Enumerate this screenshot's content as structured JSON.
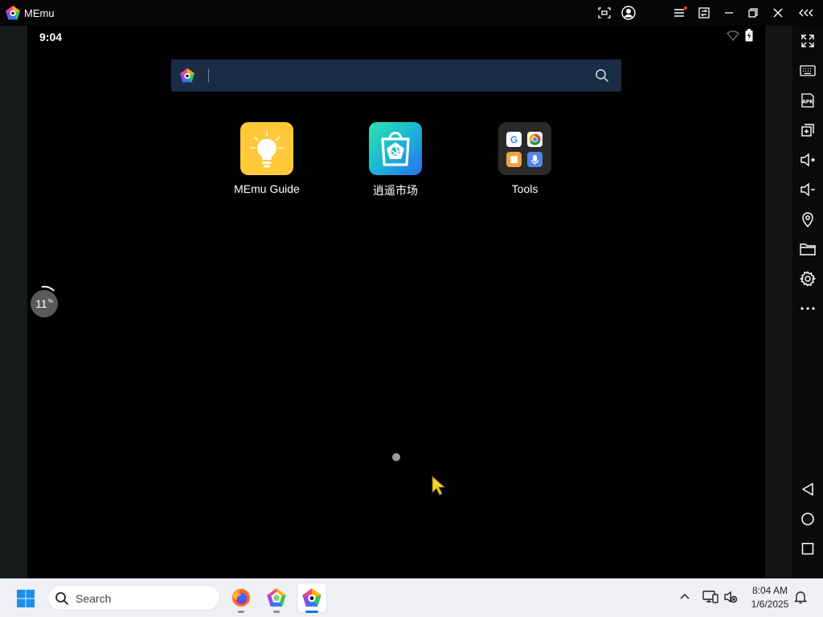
{
  "window": {
    "title": "MEmu",
    "controls": [
      "screenshot-icon",
      "account-icon",
      "menu-icon",
      "multi-window-icon",
      "minimize-icon",
      "restore-icon",
      "close-icon",
      "collapse-toolbar-icon"
    ]
  },
  "android": {
    "status_time": "9:04",
    "search": {
      "value": "",
      "placeholder": ""
    },
    "apps": [
      {
        "label": "MEmu Guide",
        "icon": "lightbulb-icon"
      },
      {
        "label": "逍遥市场",
        "icon": "market-bag-icon"
      },
      {
        "label": "Tools",
        "icon": "tools-folder-icon"
      }
    ],
    "perf_badge": {
      "value": "11",
      "unit": "%"
    }
  },
  "toolbar": {
    "items": [
      "fullscreen-icon",
      "keyboard-icon",
      "apk-icon",
      "add-window-icon",
      "volume-up-icon",
      "volume-down-icon",
      "location-icon",
      "folder-icon",
      "settings-icon",
      "more-icon",
      "back-icon",
      "home-icon",
      "recents-icon"
    ],
    "apk_text": "APK"
  },
  "taskbar": {
    "search_label": "Search",
    "time": "8:04 AM",
    "date": "1/6/2025",
    "pinned": [
      "firefox-icon",
      "memu-multi-icon",
      "memu-icon"
    ]
  },
  "colors": {
    "searchbar": "#1b2c46",
    "memu_guide": "#ffc93a",
    "accent": "#1a6fd8"
  }
}
